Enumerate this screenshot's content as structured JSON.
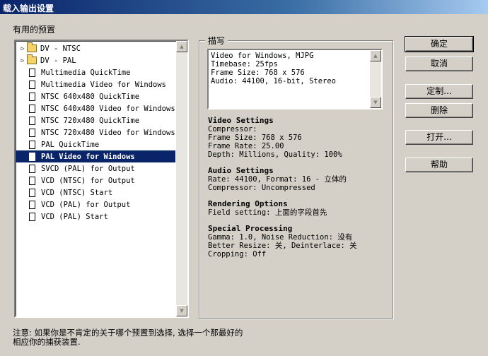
{
  "window": {
    "title": "载入输出设置"
  },
  "presets": {
    "label": "有用的预置",
    "items": [
      {
        "label": "DV - NTSC",
        "type": "folder",
        "selected": false
      },
      {
        "label": "DV - PAL",
        "type": "folder",
        "selected": false
      },
      {
        "label": "Multimedia QuickTime",
        "type": "file",
        "selected": false
      },
      {
        "label": "Multimedia Video for Windows",
        "type": "file",
        "selected": false
      },
      {
        "label": "NTSC 640x480 QuickTime",
        "type": "file",
        "selected": false
      },
      {
        "label": "NTSC 640x480 Video for Windows",
        "type": "file",
        "selected": false
      },
      {
        "label": "NTSC 720x480 QuickTime",
        "type": "file",
        "selected": false
      },
      {
        "label": "NTSC 720x480 Video for Windows",
        "type": "file",
        "selected": false
      },
      {
        "label": "PAL QuickTime",
        "type": "file",
        "selected": false
      },
      {
        "label": "PAL Video for Windows",
        "type": "file",
        "selected": true
      },
      {
        "label": "SVCD (PAL) for Output",
        "type": "file",
        "selected": false
      },
      {
        "label": "VCD (NTSC) for Output",
        "type": "file",
        "selected": false
      },
      {
        "label": "VCD (NTSC) Start",
        "type": "file",
        "selected": false
      },
      {
        "label": "VCD (PAL) for Output",
        "type": "file",
        "selected": false
      },
      {
        "label": "VCD (PAL) Start",
        "type": "file",
        "selected": false
      }
    ]
  },
  "description": {
    "title": "描写",
    "lines": [
      "Video for Windows, MJPG",
      "Timebase: 25fps",
      "Frame Size: 768 x 576",
      "Audio: 44100, 16-bit, Stereo"
    ]
  },
  "settings": [
    {
      "header": "Video Settings",
      "lines": [
        "Compressor:",
        "Frame Size: 768 x 576",
        "Frame Rate: 25.00",
        "Depth: Millions, Quality: 100%"
      ]
    },
    {
      "header": "Audio Settings",
      "lines": [
        "Rate: 44100, Format: 16 - 立体的",
        "Compressor: Uncompressed"
      ]
    },
    {
      "header": "Rendering Options",
      "lines": [
        "Field setting: 上面的字段首先"
      ]
    },
    {
      "header": "Special Processing",
      "lines": [
        "Gamma: 1.0, Noise Reduction: 没有",
        "Better Resize: 关, Deinterlace: 关",
        "Cropping: Off"
      ]
    }
  ],
  "buttons": {
    "ok": "确定",
    "cancel": "取消",
    "customize": "定制...",
    "delete": "删除",
    "open": "打开...",
    "help": "帮助"
  },
  "note": "注意: 如果你是不肯定的关于哪个预置到选择, 选择一个那最好的相应你的捕获装置."
}
